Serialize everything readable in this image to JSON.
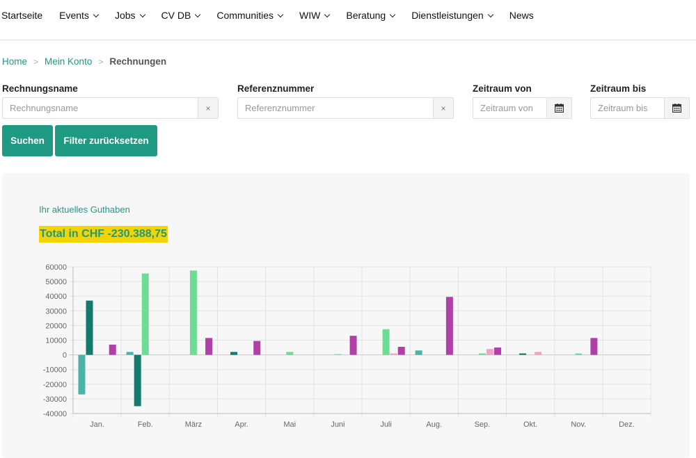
{
  "nav": {
    "items": [
      {
        "label": "Startseite",
        "dropdown": false
      },
      {
        "label": "Events",
        "dropdown": true
      },
      {
        "label": "Jobs",
        "dropdown": true
      },
      {
        "label": "CV DB",
        "dropdown": true
      },
      {
        "label": "Communities",
        "dropdown": true
      },
      {
        "label": "WIW",
        "dropdown": true
      },
      {
        "label": "Beratung",
        "dropdown": true
      },
      {
        "label": "Dienstleistungen",
        "dropdown": true
      },
      {
        "label": "News",
        "dropdown": false
      }
    ]
  },
  "breadcrumb": {
    "home": "Home",
    "account": "Mein Konto",
    "current": "Rechnungen",
    "separator": ">"
  },
  "filters": {
    "name_label": "Rechnungsname",
    "name_placeholder": "Rechnungsname",
    "ref_label": "Referenznummer",
    "ref_placeholder": "Referenznummer",
    "from_label": "Zeitraum von",
    "from_placeholder": "Zeitraum von",
    "to_label": "Zeitraum bis",
    "to_placeholder": "Zeitraum bis",
    "clear_icon": "×",
    "search_button": "Suchen",
    "reset_button": "Filter zurücksetzen"
  },
  "balance": {
    "heading": "Ihr aktuelles Guthaben",
    "total": "Total in CHF -230.388,75"
  },
  "colors": {
    "accent": "#1e9a83",
    "highlight": "#f5d300",
    "series": [
      "#4db3a6",
      "#147a6b",
      "#6fdc95",
      "#f0a5c3",
      "#b040a8"
    ]
  },
  "chart_data": {
    "type": "bar",
    "categories": [
      "Jan.",
      "Feb.",
      "März",
      "Apr.",
      "Mai",
      "Juni",
      "Juli",
      "Aug.",
      "Sep.",
      "Okt.",
      "Nov.",
      "Dez."
    ],
    "ylim": [
      -40000,
      60000
    ],
    "yticks": [
      60000,
      50000,
      40000,
      30000,
      20000,
      10000,
      0,
      -10000,
      -20000,
      -30000,
      -40000
    ],
    "grid": true,
    "series": [
      {
        "values": [
          -27000,
          2000,
          0,
          0,
          0,
          0,
          0,
          3000,
          0,
          0,
          0,
          0
        ]
      },
      {
        "values": [
          37000,
          -35000,
          0,
          2000,
          0,
          0,
          0,
          0,
          0,
          1000,
          0,
          0
        ]
      },
      {
        "values": [
          0,
          55500,
          57500,
          0,
          2000,
          500,
          17500,
          0,
          1000,
          0,
          1000,
          0
        ]
      },
      {
        "values": [
          0,
          0,
          0,
          0,
          0,
          0,
          1000,
          0,
          4000,
          2000,
          0,
          0
        ]
      },
      {
        "values": [
          7000,
          0,
          11500,
          9500,
          0,
          13000,
          5500,
          39500,
          5000,
          0,
          11500,
          0
        ]
      }
    ]
  }
}
